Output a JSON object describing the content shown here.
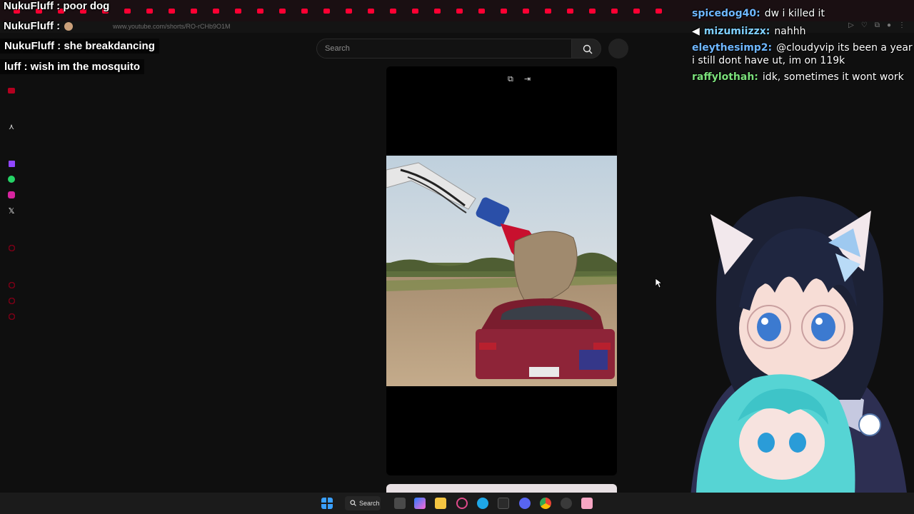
{
  "browser": {
    "url": "www.youtube.com/shorts/RO-rCHb9O1M",
    "tab_count": 30
  },
  "youtube": {
    "search": {
      "placeholder": "Search"
    },
    "search_icon": "search-icon",
    "mic_icon": "mic-icon",
    "rail_icons": [
      "youtube-icon",
      "arrow-up-icon",
      "twitch-icon",
      "whatsapp-icon",
      "instagram-icon",
      "x-icon",
      "youtube-icon",
      "youtube-icon",
      "youtube-icon",
      "youtube-icon"
    ],
    "player_controls": [
      "open-icon",
      "exit-icon"
    ]
  },
  "stream_chat_left": [
    {
      "user": "NukuFluff",
      "text": "poor dog"
    },
    {
      "user": "NukuFluff",
      "text": ""
    },
    {
      "user": "NukuFluff",
      "text": "she breakdancing"
    },
    {
      "user": "luff",
      "text": "wish im the mosquito"
    }
  ],
  "stream_chat_right": [
    {
      "user": "spicedog40:",
      "text": "dw i killed it",
      "color": "#6fb7ff"
    },
    {
      "user": "mizumiizzx:",
      "text": "nahhh",
      "color": "#7fd0ff"
    },
    {
      "user": "eleythesimp2:",
      "text": "@cloudyvip its been a year a",
      "color": "#6fb7ff"
    },
    {
      "user": "",
      "text": "i still dont have ut, im on 119k",
      "color": "#ffffff"
    },
    {
      "user": "raffylothah:",
      "text": "idk, sometimes it wont work",
      "color": "#7be07b"
    }
  ],
  "taskbar": {
    "search_label": "Search",
    "icons": [
      "windows-start-icon",
      "task-view-icon",
      "copilot-icon",
      "file-explorer-icon",
      "obs-icon",
      "edge-icon",
      "terminal-icon",
      "discord-icon",
      "chrome-icon",
      "settings-icon",
      "app-icon"
    ]
  },
  "colors": {
    "accent": "#ff0033",
    "background": "#0f0f0f"
  }
}
